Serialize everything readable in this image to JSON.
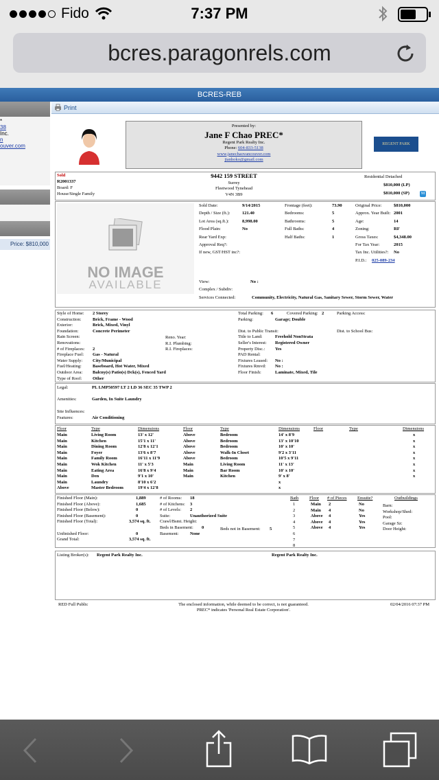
{
  "status": {
    "carrier": "Fido",
    "time": "7:37 PM"
  },
  "browser": {
    "url": "bcres.paragonrels.com"
  },
  "site": {
    "banner": "BCRES-REB"
  },
  "left": {
    "l1": "*",
    "l2": "38",
    "l3": "Inc.",
    "l4": "n",
    "l5": "ouver.com",
    "price": "Price: $810,000"
  },
  "toolbar": {
    "print": "Print"
  },
  "agent": {
    "presented": "Presented by:",
    "name": "Jane F Chao PREC*",
    "office": "Regent Park Realty Inc.",
    "phone_label": "Phone:",
    "phone": "604-833-5138",
    "web": "www.janechaovancouver.com",
    "email": "jianhoko@gmail.com",
    "logo": "REGENT PARK"
  },
  "listing": {
    "status": "Sold",
    "mls": "R2001337",
    "board": "Board: F",
    "type": "House/Single Family",
    "address": "9442 159 STREET",
    "city": "Surrey",
    "area": "Fleetwood Tynehead",
    "postal": "V4N 3B9",
    "category": "Residential Detached",
    "lp": "$810,000 (LP)",
    "sp": "$810,000 (SP)",
    "badge": "M"
  },
  "noimage": {
    "line1": "NO IMAGE",
    "line2": "AVAILABLE"
  },
  "facts": {
    "c1": [
      [
        "Sold Date:",
        "9/14/2015"
      ],
      [
        "Depth / Size (ft.):",
        "121.40"
      ],
      [
        "Lot Area (sq.ft.):",
        "8,998.00"
      ],
      [
        "Flood Plain:",
        "No"
      ],
      [
        "Rear Yard Exp:",
        ""
      ],
      [
        "Approval Req?:",
        ""
      ],
      [
        "If new, GST/HST inc?:",
        ""
      ]
    ],
    "c2": [
      [
        "Frontage (feet):",
        "73.90"
      ],
      [
        "Bedrooms:",
        "5"
      ],
      [
        "Bathrooms:",
        "5"
      ],
      [
        "Full Baths:",
        "4"
      ],
      [
        "Half Baths:",
        "1"
      ]
    ],
    "c3": [
      [
        "Original Price:",
        "$810,000"
      ],
      [
        "Approx. Year Built:",
        "2001"
      ],
      [
        "Age:",
        "14"
      ],
      [
        "Zoning:",
        "RF"
      ],
      [
        "Gross Taxes:",
        "$4,348.00"
      ],
      [
        "For Tax Year:",
        "2015"
      ],
      [
        "Tax Inc. Utilities?:",
        "No"
      ],
      [
        "P.I.D.:",
        "025-089-234"
      ]
    ],
    "view": "View:",
    "view_val": "No  :",
    "complex": "Complex / Subdiv:",
    "services": "Services Connected:",
    "services_val": "Community, Electricity, Natural Gas, Sanitary Sewer, Storm Sewer, Water"
  },
  "details": {
    "left": [
      [
        "Style of Home:",
        "2 Storey"
      ],
      [
        "Construction:",
        "Brick, Frame - Wood"
      ],
      [
        "Exterior:",
        "Brick, Mixed, Vinyl"
      ],
      [
        "Foundation:",
        "Concrete Perimeter"
      ],
      [
        "Rain Screen:",
        ""
      ],
      [
        "Renovations:",
        ""
      ],
      [
        "# of Fireplaces:",
        "2"
      ],
      [
        "Fireplace Fuel:",
        "Gas - Natural"
      ],
      [
        "Water Supply:",
        "City/Municipal"
      ],
      [
        "Fuel/Heating:",
        "Baseboard, Hot Water, Mixed"
      ],
      [
        "Outdoor Area:",
        "Balcny(s) Patio(s) Dck(s), Fenced Yard"
      ],
      [
        "Type of Roof:",
        "Other"
      ]
    ],
    "mid": [
      "Reno. Year:",
      "R.I. Plumbing:",
      "R.I. Fireplaces:"
    ],
    "right": [
      [
        "Total Parking:",
        "6"
      ],
      [
        "Parking:",
        "Garage; Double"
      ],
      [
        "",
        ""
      ],
      [
        "Dist. to Public Transit:",
        ""
      ],
      [
        "Title to Land:",
        "Freehold NonStrata"
      ],
      [
        "Seller's Interest:",
        "Registered Owner"
      ],
      [
        "Property Disc.:",
        "Yes"
      ],
      [
        "PAD Rental:",
        ""
      ],
      [
        "Fixtures Leased:",
        "No  :"
      ],
      [
        "Fixtures Rmvd:",
        "No  :"
      ],
      [
        "Floor Finish:",
        "Laminate, Mixed, Tile"
      ]
    ],
    "covered": "Covered Parking:",
    "covered_val": "2",
    "access": "Parking Access:",
    "school": "Dist. to School Bus:"
  },
  "legal": {
    "legal_l": "Legal:",
    "legal_v": "PL LMP50597 LT 2 LD 36 SEC 35 TWP 2",
    "amen_l": "Amenities:",
    "amen_v": "Garden, In Suite Laundry",
    "site_l": "Site Influences:",
    "feat_l": "Features:",
    "feat_v": "Air Conditioning"
  },
  "rooms": {
    "headers": [
      "Floor",
      "Type",
      "Dimensions"
    ],
    "col1": [
      [
        "Main",
        "Living Room",
        "13' x 12'"
      ],
      [
        "Main",
        "Kitchen",
        "15'1 x 11'"
      ],
      [
        "Main",
        "Dining Room",
        "12'8 x 12'1"
      ],
      [
        "Main",
        "Foyer",
        "13'6 x 8'7"
      ],
      [
        "Main",
        "Family Room",
        "16'11 x 11'9"
      ],
      [
        "Main",
        "Wok Kitchen",
        "11' x 5'3"
      ],
      [
        "Main",
        "Eating Area",
        "16'8 x 9'4"
      ],
      [
        "Main",
        "Den",
        "9'1 x 10'"
      ],
      [
        "Main",
        "Laundry",
        "8'10 x 6'2"
      ],
      [
        "Above",
        "Master Bedroom",
        "19'4 x 12'8"
      ]
    ],
    "col2": [
      [
        "Above",
        "Bedroom",
        "14' x 8'9"
      ],
      [
        "Above",
        "Bedroom",
        "13' x 10'10"
      ],
      [
        "Above",
        "Bedroom",
        "10' x 10'"
      ],
      [
        "Above",
        "Walk-In Closet",
        "9'2 x 3'11"
      ],
      [
        "Above",
        "Bedroom",
        "10'5 x 9'11"
      ],
      [
        "Main",
        "Living Room",
        "11' x 13'"
      ],
      [
        "Main",
        "Bar Room",
        "10' x 10'"
      ],
      [
        "Main",
        "Kitchen",
        "9' x 8'"
      ],
      [
        "",
        "",
        "x"
      ],
      [
        "",
        "",
        "x"
      ]
    ],
    "col3": [
      "x",
      "x",
      "x",
      "x",
      "x",
      "x",
      "x",
      "x"
    ]
  },
  "area": {
    "rows": [
      [
        "Finished Floor (Main):",
        "1,889"
      ],
      [
        "Finished Floor (Above):",
        "1,685"
      ],
      [
        "Finished Floor (Below):",
        "0"
      ],
      [
        "Finished Floor (Basement):",
        "0"
      ],
      [
        "Finished Floor (Total):",
        "3,574 sq. ft."
      ],
      [
        "",
        ""
      ],
      [
        "Unfinished Floor:",
        "0"
      ],
      [
        "Grand Total:",
        "3,574 sq. ft."
      ]
    ],
    "mid": [
      [
        "# of Rooms:",
        "18"
      ],
      [
        "# of Kitchens:",
        "3"
      ],
      [
        "# of Levels:",
        "2"
      ],
      [
        "Suite:",
        "Unauthorized Suite"
      ],
      [
        "Crawl/Bsmt. Height:",
        ""
      ],
      [
        "Beds in Basement:",
        "0"
      ],
      [
        "Basement:",
        "None"
      ]
    ],
    "beds_not": "Beds not in Basement:",
    "beds_not_val": "5",
    "bath_headers": [
      "Bath",
      "Floor",
      "# of Pieces",
      "Ensuite?"
    ],
    "baths": [
      [
        "1",
        "Main",
        "2",
        "No"
      ],
      [
        "2",
        "Main",
        "4",
        "No"
      ],
      [
        "3",
        "Above",
        "4",
        "Yes"
      ],
      [
        "4",
        "Above",
        "4",
        "Yes"
      ],
      [
        "5",
        "Above",
        "4",
        "Yes"
      ],
      [
        "6",
        "",
        "",
        " "
      ],
      [
        "7",
        "",
        "",
        " "
      ],
      [
        "8",
        "",
        "",
        " "
      ]
    ],
    "out_header": "Outbuildings",
    "out": [
      "Barn:",
      "Workshop/Shed:",
      "Pool:",
      "Garage Sz:",
      "Door Height:"
    ]
  },
  "broker": {
    "label": "Listing Broker(s):",
    "b1": "Regent Park Realty Inc.",
    "b2": "Regent Park Realty Inc."
  },
  "footer": {
    "left": "RED Full Public",
    "mid1": "The enclosed information, while deemed to be correct, is not guaranteed.",
    "mid2": "PREC* indicates 'Personal Real Estate Corporation'.",
    "right": "02/04/2016 07:37 PM"
  }
}
